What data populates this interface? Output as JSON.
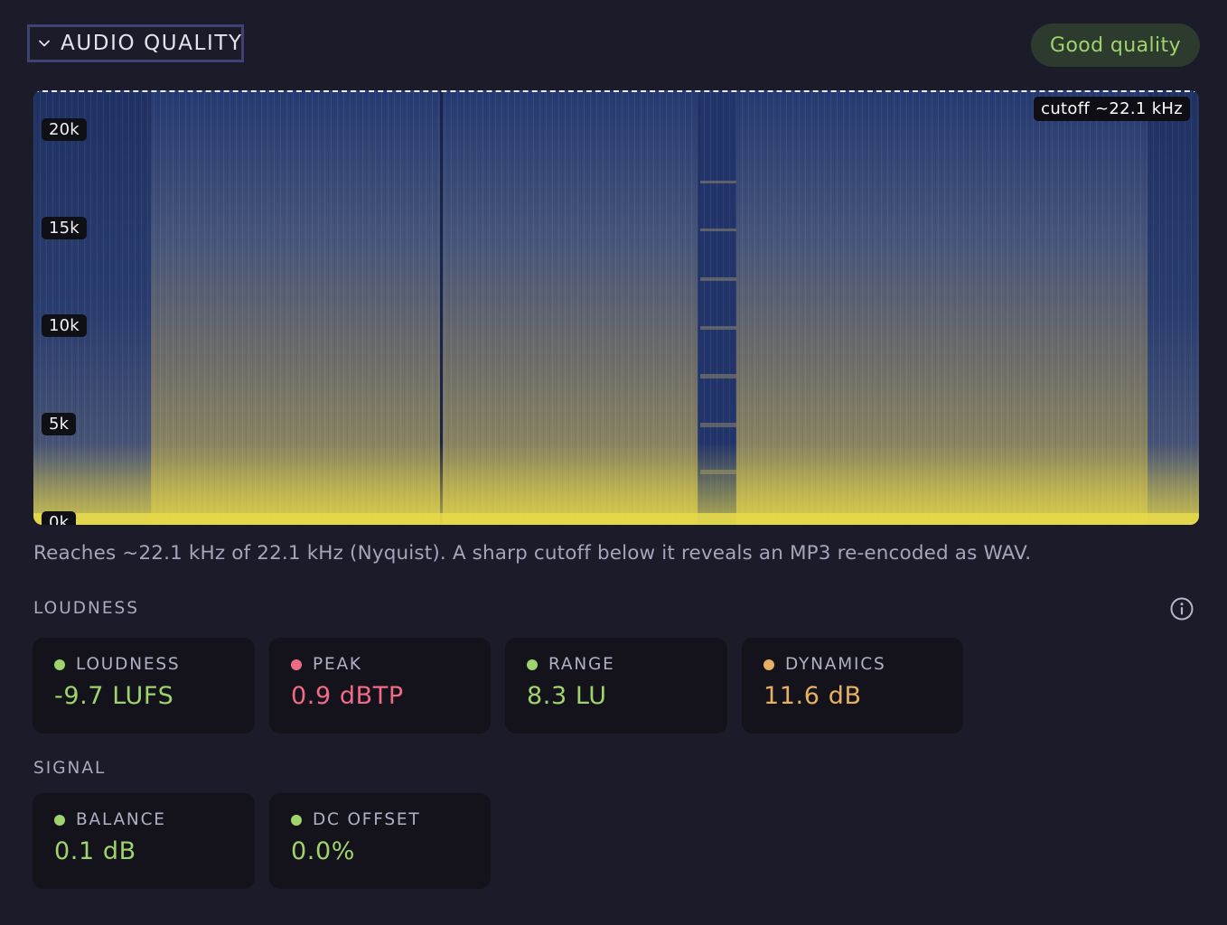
{
  "header": {
    "section_title": "AUDIO QUALITY",
    "badge": "Good quality"
  },
  "spectrogram": {
    "cutoff_label": "cutoff ~22.1 kHz",
    "ticks": [
      "20k",
      "15k",
      "10k",
      "5k",
      "0k"
    ],
    "caption": "Reaches ~22.1 kHz of 22.1 kHz (Nyquist). A sharp cutoff below it reveals an MP3 re-encoded as WAV."
  },
  "loudness": {
    "title": "LOUDNESS",
    "cards": [
      {
        "label": "LOUDNESS",
        "value": "-9.7 LUFS",
        "color": "#9fd36b"
      },
      {
        "label": "PEAK",
        "value": "0.9 dBTP",
        "color": "#f06b86"
      },
      {
        "label": "RANGE",
        "value": "8.3 LU",
        "color": "#9fd36b"
      },
      {
        "label": "DYNAMICS",
        "value": "11.6 dB",
        "color": "#e7b061"
      }
    ]
  },
  "signal": {
    "title": "SIGNAL",
    "cards": [
      {
        "label": "BALANCE",
        "value": "0.1 dB",
        "color": "#9fd36b"
      },
      {
        "label": "DC OFFSET",
        "value": "0.0%",
        "color": "#9fd36b"
      }
    ]
  },
  "icons": {
    "toggle": "chevron-down-icon",
    "info": "info-icon"
  }
}
